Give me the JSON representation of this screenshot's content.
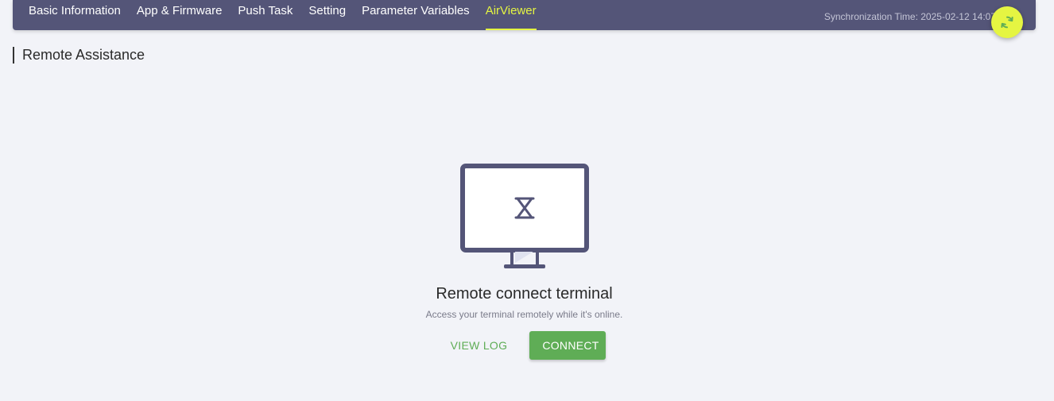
{
  "nav": {
    "tabs": [
      {
        "label": "Basic Information"
      },
      {
        "label": "App & Firmware"
      },
      {
        "label": "Push Task"
      },
      {
        "label": "Setting"
      },
      {
        "label": "Parameter Variables"
      },
      {
        "label": "AirViewer",
        "active": true
      }
    ],
    "sync_time": "Synchronization Time: 2025-02-12 14:07",
    "sync_icon": "refresh-icon"
  },
  "section": {
    "title": "Remote Assistance"
  },
  "empty_state": {
    "icon": "monitor-hourglass-icon",
    "title": "Remote connect terminal",
    "subtitle": "Access your terminal remotely while it's online.",
    "view_log_label": "VIEW LOG",
    "connect_label": "CONNECT"
  },
  "colors": {
    "nav_bg": "#545578",
    "accent": "#e5f542",
    "primary_green": "#5fad56",
    "monitor": "#545578"
  }
}
